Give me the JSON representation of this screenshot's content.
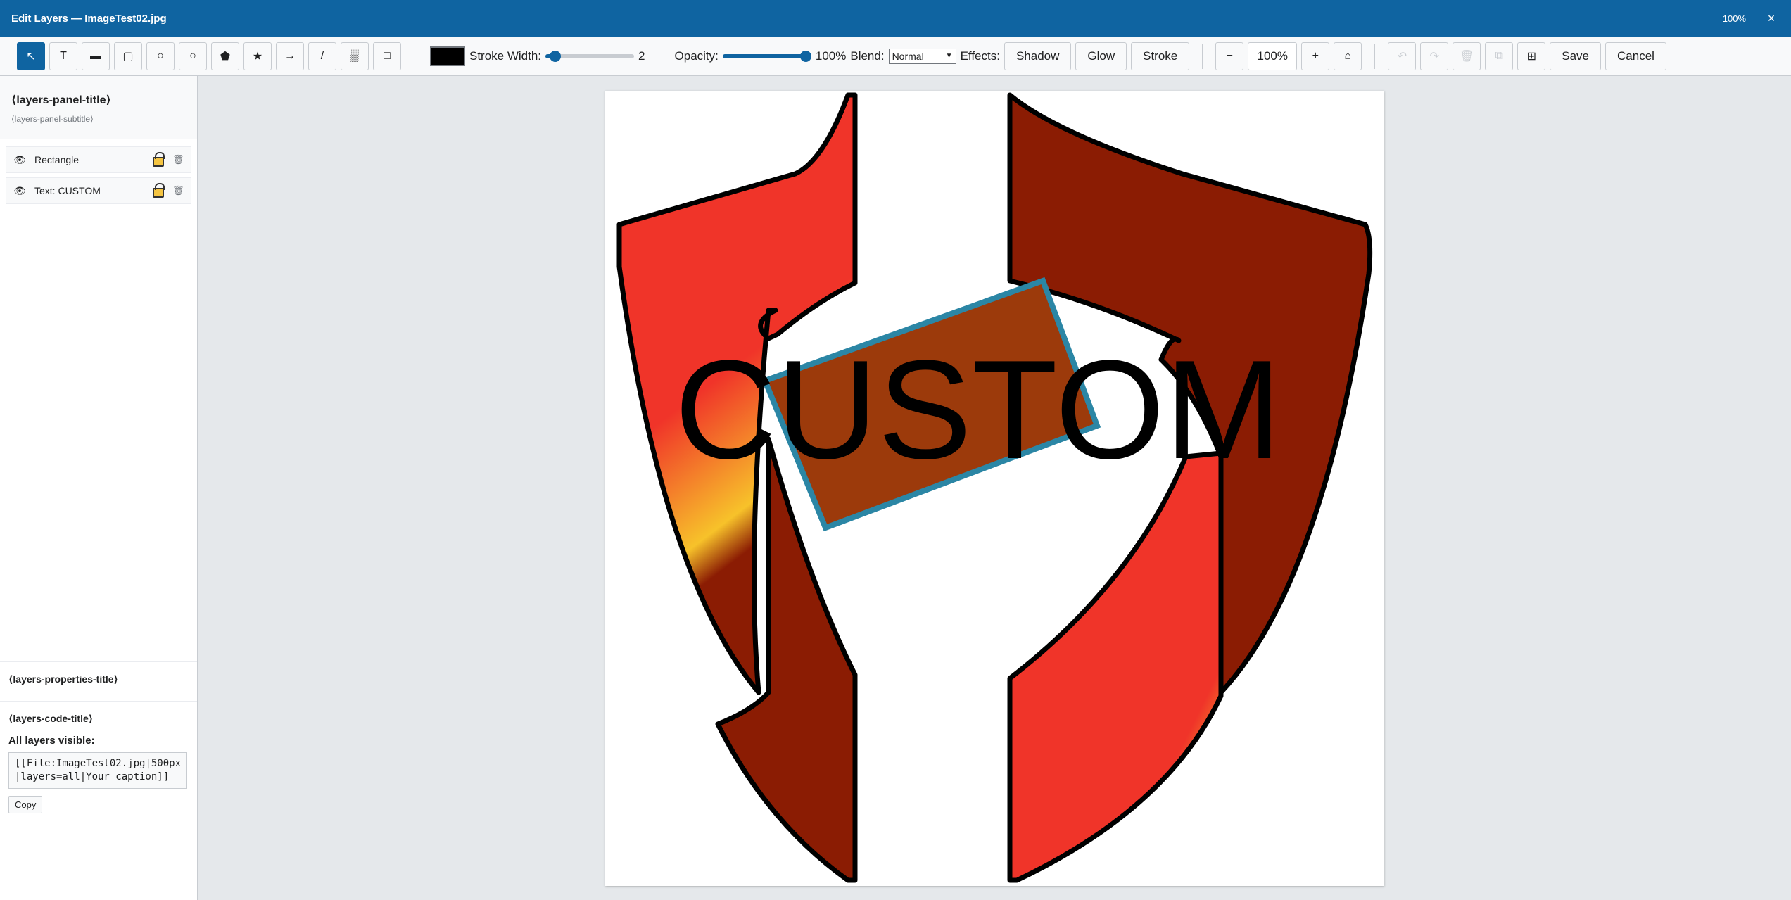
{
  "window": {
    "title": "Edit Layers — ImageTest02.jpg",
    "zoom_indicator": "100%",
    "close_glyph": "×"
  },
  "toolbar": {
    "tools": [
      {
        "name": "select-tool",
        "glyph": "↖",
        "active": true
      },
      {
        "name": "text-tool",
        "glyph": "T"
      },
      {
        "name": "text-box-tool",
        "glyph": "▬"
      },
      {
        "name": "rectangle-tool",
        "glyph": "▢"
      },
      {
        "name": "circle-tool",
        "glyph": "○"
      },
      {
        "name": "ellipse-tool",
        "glyph": "○"
      },
      {
        "name": "polygon-tool",
        "glyph": "⬟"
      },
      {
        "name": "star-tool",
        "glyph": "★"
      },
      {
        "name": "arrow-tool",
        "glyph": "→"
      },
      {
        "name": "line-tool",
        "glyph": "/"
      },
      {
        "name": "blur-tool",
        "glyph": "▒"
      },
      {
        "name": "custom-shape-tool",
        "glyph": "□"
      }
    ],
    "stroke_color": "#000000",
    "stroke_width_label": "Stroke Width:",
    "stroke_width_value": "2",
    "stroke_width_level": 0.05,
    "opacity_label": "Opacity:",
    "opacity_value": "100%",
    "opacity_level": 1.0,
    "blend_label": "Blend:",
    "blend_value": "Normal",
    "effects_label": "Effects:",
    "effects": [
      "Shadow",
      "Glow",
      "Stroke"
    ],
    "zoom_out": "−",
    "zoom_value": "100%",
    "zoom_in": "+",
    "zoom_reset_glyph": "⌂",
    "undo_glyph": "↶",
    "redo_glyph": "↷",
    "delete_glyph": "🗑",
    "duplicate_glyph": "⧉",
    "grid_glyph": "⊞",
    "save_label": "Save",
    "cancel_label": "Cancel"
  },
  "layers_panel": {
    "title": "⟨layers-panel-title⟩",
    "subtitle": "⟨layers-panel-subtitle⟩",
    "layers": [
      {
        "name": "Rectangle"
      },
      {
        "name": "Text: CUSTOM"
      }
    ],
    "properties_title": "⟨layers-properties-title⟩",
    "code_title": "⟨layers-code-title⟩",
    "visible_label": "All layers visible:",
    "code_text": "[[File:ImageTest02.jpg|500px|layers=all|Your caption]]",
    "copy_label": "Copy"
  },
  "canvas": {
    "text_layer": "CUSTOM",
    "shield_light": "#f03429",
    "shield_dark": "#8b1c03",
    "shield_highlight": "#f7c22a",
    "rect_fill": "#9c3a0b",
    "rect_stroke": "#2b86a5",
    "text_color": "#000000"
  }
}
